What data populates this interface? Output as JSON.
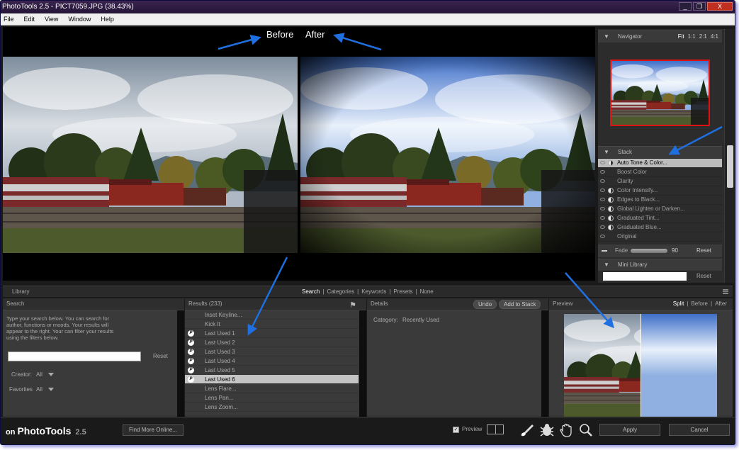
{
  "window": {
    "title": "PhotoTools 2.5 - PICT7059.JPG (38.43%)",
    "controls": [
      "_",
      "❐",
      "X"
    ]
  },
  "menu": [
    "File",
    "Edit",
    "View",
    "Window",
    "Help"
  ],
  "compare": {
    "before_label": "Before",
    "after_label": "After"
  },
  "navigator": {
    "title": "Navigator",
    "zoom_options": [
      "Fit",
      "1:1",
      "2:1",
      "4:1"
    ],
    "active_zoom": "Fit"
  },
  "stack": {
    "title": "Stack",
    "items": [
      {
        "label": "Auto Tone & Color...",
        "selected": true,
        "filter": true
      },
      {
        "label": "Boost Color",
        "selected": false,
        "filter": false
      },
      {
        "label": "Clarity",
        "selected": false,
        "filter": false
      },
      {
        "label": "Color Intensify...",
        "selected": false,
        "filter": true
      },
      {
        "label": "Edges to Black...",
        "selected": false,
        "filter": true
      },
      {
        "label": "Global Lighten or Darken...",
        "selected": false,
        "filter": true
      },
      {
        "label": "Graduated Tint...",
        "selected": false,
        "filter": true
      },
      {
        "label": "Graduated Blue...",
        "selected": false,
        "filter": true
      },
      {
        "label": "Original",
        "selected": false,
        "filter": false
      }
    ],
    "fade_label": "Fade",
    "fade_value": "90",
    "fade_level": 0.9,
    "reset_label": "Reset"
  },
  "mini_library": {
    "title": "Mini Library",
    "reset_label": "Reset"
  },
  "library": {
    "title": "Library",
    "tabs": [
      "Search",
      "Categories",
      "Keywords",
      "Presets",
      "None"
    ],
    "active_tab": "Search"
  },
  "search": {
    "title": "Search",
    "help_text": "Type your search below. You can search for author, functions or moods. Your results will appear to the right. Your can filter your results using the filters below.",
    "input_value": "",
    "reset_label": "Reset",
    "creator_label": "Creator:",
    "creator_value": "All",
    "favorites_label": "Favorites",
    "favorites_value": "All"
  },
  "results": {
    "title": "Results (233)",
    "items": [
      {
        "label": "Inset Keyline...",
        "badge": false,
        "selected": false
      },
      {
        "label": "Kick It",
        "badge": false,
        "selected": false
      },
      {
        "label": "Last Used 1",
        "badge": true,
        "selected": false
      },
      {
        "label": "Last Used 2",
        "badge": true,
        "selected": false
      },
      {
        "label": "Last Used 3",
        "badge": true,
        "selected": false
      },
      {
        "label": "Last Used 4",
        "badge": true,
        "selected": false
      },
      {
        "label": "Last Used 5",
        "badge": true,
        "selected": false
      },
      {
        "label": "Last Used 6",
        "badge": true,
        "selected": true
      },
      {
        "label": "Lens Flare...",
        "badge": false,
        "selected": false
      },
      {
        "label": "Lens Pan...",
        "badge": false,
        "selected": false
      },
      {
        "label": "Lens Zoom...",
        "badge": false,
        "selected": false
      }
    ]
  },
  "details": {
    "title": "Details",
    "undo_label": "Undo",
    "add_to_stack_label": "Add to Stack",
    "category_label": "Category:",
    "category_value": "Recently Used"
  },
  "preview_pane": {
    "title": "Preview",
    "modes": [
      "Split",
      "Before",
      "After"
    ],
    "active_mode": "Split"
  },
  "footer": {
    "logo_on": "on",
    "logo_name": "PhotoTools",
    "logo_version": "2.5",
    "find_more_label": "Find More Online...",
    "preview_checkbox_label": "Preview",
    "preview_checked": true,
    "apply_label": "Apply",
    "cancel_label": "Cancel",
    "tools": [
      "brush-icon",
      "bug-icon",
      "hand-icon",
      "zoom-icon"
    ]
  },
  "colors": {
    "annotation_arrow": "#1f6fe0",
    "navigator_frame": "#e01010",
    "title_bar": "#2e1c44"
  }
}
